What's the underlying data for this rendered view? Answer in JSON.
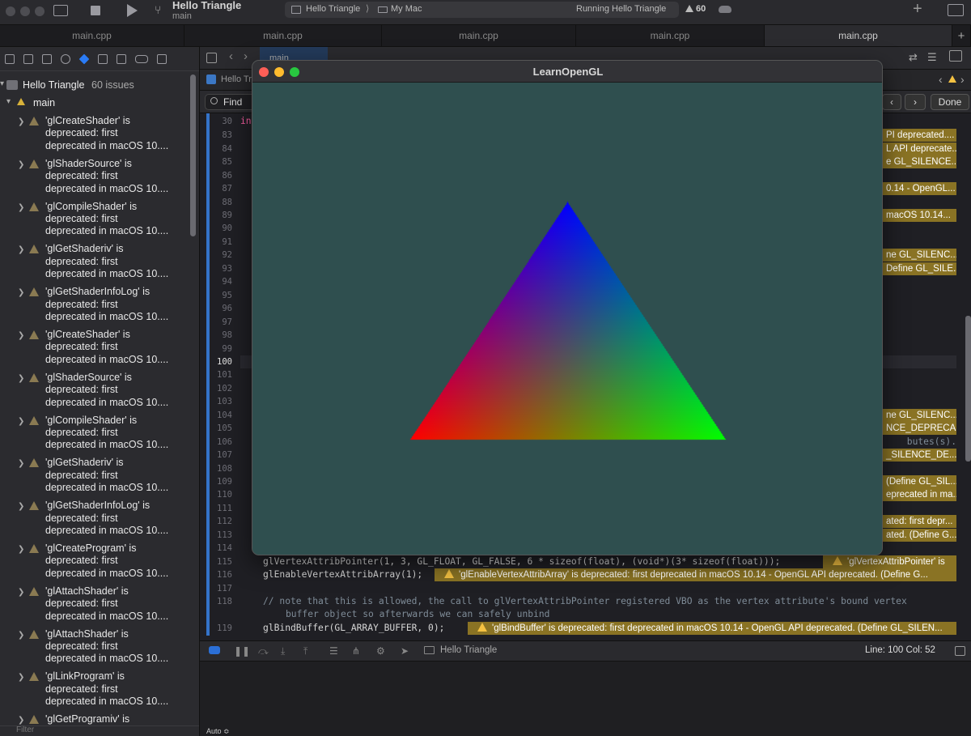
{
  "toolbar": {
    "project": "Hello Triangle",
    "target": "main",
    "scheme": "Hello Triangle",
    "destination": "My Mac",
    "status": "Running Hello Triangle",
    "warnings": "60"
  },
  "tabs": [
    "main.cpp",
    "main.cpp",
    "main.cpp",
    "main.cpp",
    "main.cpp"
  ],
  "navigator": {
    "project": "Hello Triangle",
    "issue_count": "60 issues",
    "group": "main",
    "issues": [
      [
        "'glCreateShader' is",
        "deprecated: first",
        "deprecated in macOS 10...."
      ],
      [
        "'glShaderSource' is",
        "deprecated: first",
        "deprecated in macOS 10...."
      ],
      [
        "'glCompileShader' is",
        "deprecated: first",
        "deprecated in macOS 10...."
      ],
      [
        "'glGetShaderiv' is",
        "deprecated: first",
        "deprecated in macOS 10...."
      ],
      [
        "'glGetShaderInfoLog' is",
        "deprecated: first",
        "deprecated in macOS 10...."
      ],
      [
        "'glCreateShader' is",
        "deprecated: first",
        "deprecated in macOS 10...."
      ],
      [
        "'glShaderSource' is",
        "deprecated: first",
        "deprecated in macOS 10...."
      ],
      [
        "'glCompileShader' is",
        "deprecated: first",
        "deprecated in macOS 10...."
      ],
      [
        "'glGetShaderiv' is",
        "deprecated: first",
        "deprecated in macOS 10...."
      ],
      [
        "'glGetShaderInfoLog' is",
        "deprecated: first",
        "deprecated in macOS 10...."
      ],
      [
        "'glCreateProgram' is",
        "deprecated: first",
        "deprecated in macOS 10...."
      ],
      [
        "'glAttachShader' is",
        "deprecated: first",
        "deprecated in macOS 10...."
      ],
      [
        "'glAttachShader' is",
        "deprecated: first",
        "deprecated in macOS 10...."
      ],
      [
        "'glLinkProgram' is",
        "deprecated: first",
        "deprecated in macOS 10...."
      ],
      [
        "'glGetProgramiv' is",
        "",
        ""
      ]
    ],
    "filter_placeholder": "Filter"
  },
  "editor": {
    "breadcrumb_tab": "main",
    "crumb": "Hello Tr",
    "find_placeholder": "Find",
    "done_label": "Done",
    "first_line": "30",
    "first_code": "in",
    "line_numbers": [
      "83",
      "84",
      "85",
      "86",
      "87",
      "88",
      "89",
      "90",
      "91",
      "92",
      "93",
      "94",
      "95",
      "96",
      "97",
      "98",
      "99",
      "100",
      "101",
      "102",
      "103",
      "104",
      "105",
      "106",
      "107",
      "108",
      "109",
      "110",
      "111",
      "112",
      "113",
      "114",
      "115",
      "116",
      "117",
      "118",
      "",
      "119"
    ],
    "right_warnings": {
      "83": "PI deprecated....",
      "84": "L API deprecate...",
      "85": "e GL_SILENCE...",
      "87": "0.14 - OpenGL...",
      "89": "macOS 10.14...",
      "92": "ne GL_SILENC...",
      "93": "Define GL_SILE...",
      "104": "ne GL_SILENC...",
      "105": "NCE_DEPRECA...",
      "107": "_SILENCE_DE...",
      "109": "(Define GL_SIL...",
      "110": "eprecated in ma...",
      "112": "ated: first depr...",
      "113": "ated. (Define G..."
    },
    "line106_tail": "butes(s).",
    "code115": "glVertexAttribPointer(1, 3, GL_FLOAT, GL_FALSE, 6 * sizeof(float), (void*)(3* sizeof(float)));",
    "warn115": "'glVertexAttribPointer' is",
    "code116": "glEnableVertexAttribArray(1);",
    "warn116": "'glEnableVertexAttribArray' is deprecated: first deprecated in macOS 10.14 - OpenGL API deprecated. (Define G...",
    "code118a": "// note that this is allowed, the call to glVertexAttribPointer registered VBO as the vertex attribute's bound vertex",
    "code118b": "buffer object so afterwards we can safely unbind",
    "code119": "glBindBuffer(GL_ARRAY_BUFFER, 0);",
    "warn119": "'glBindBuffer' is deprecated: first deprecated in macOS 10.14 - OpenGL API deprecated. (Define GL_SILEN...",
    "status_target": "Hello Triangle",
    "line_col": "Line: 100  Col: 52"
  },
  "debug": {
    "auto_label": "Auto ≎"
  },
  "glwindow": {
    "title": "LearnOpenGL",
    "clear_color": "#2f4f4f",
    "vertex_colors": {
      "top": "#0000ff",
      "left": "#ff0000",
      "right": "#00ff00"
    }
  }
}
